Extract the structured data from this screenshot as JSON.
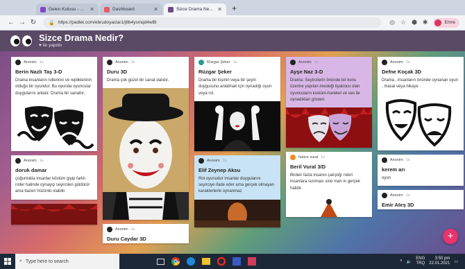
{
  "browser": {
    "tabs": [
      {
        "label": "Gelen Kutusu - Yahoo Search",
        "color": "#7b4bc4"
      },
      {
        "label": "Dashboard",
        "color": "#e35b6c"
      },
      {
        "label": "Sizce Drama Nedir?",
        "color": "#6d4a86"
      }
    ],
    "url": "https://padlet.com/ebrudoyaclar1/j8b4ysmqd4wBl",
    "profile_label": "Emre"
  },
  "padlet": {
    "title": "Sizce Drama Nedir?",
    "subtitle": "♥ ile yapıldı"
  },
  "columns": [
    {
      "cards": [
        {
          "author": "Anonim",
          "time": "1s",
          "title": "Berin Nazlı Taş 3-D",
          "body": "Drama insanların rollerinin ve repliklerinin olduğu bir oyundur. Bu oyunda oyuncular duygularını anlatır. Drama bir sanattır.",
          "image": "masks-bw-1"
        },
        {
          "author": "Anonim",
          "time": "1s",
          "title": "doruk damar",
          "body": "çoğunlukla insanlar köstüm giyip farklı roller halinde oynayıp seyircileri güldürür ama bazen hüzünlü olabilir.",
          "image": ""
        },
        {
          "author": "",
          "time": "",
          "title": "",
          "body": "",
          "image": "red-curtain-small"
        }
      ]
    },
    {
      "cards": [
        {
          "author": "Anonim",
          "time": "1s",
          "title": "Duru 3D",
          "body": "Drama çok güzel bir sanat dalıdır.",
          "image": "mime-boy"
        },
        {
          "author": "Anonim",
          "time": "1s",
          "title": "Duru Caydar 3D",
          "body": "",
          "image": ""
        }
      ]
    },
    {
      "cards": [
        {
          "author": "Rüzgar Şeker",
          "time": "1s",
          "title": "Rüzgar Şeker",
          "body": "Drama bir kişinin veya bir şeyin duygusunu anlatmak için oynadığı oyun veya rol.",
          "image": "mime-woman"
        },
        {
          "author": "Anonim",
          "time": "1s",
          "title": "Elif  Zeynep  Aksu",
          "body": "Rol oyunudur insanlar duygularını seyirciye ifade eder ama  gerçek olmayan karakterlerle oynanmaz",
          "image": "stage-dark",
          "tone": "blue"
        }
      ]
    },
    {
      "cards": [
        {
          "author": "Anonim",
          "time": "1s",
          "title": "Ayşe Naz 3-D",
          "body": "Drama: Seyircilerin önünde bir konu üzerine  yapılan mesleği tiyatrocu olan oyuncuların kostüm-hareket ve ses ile oynadıkları gösteri.",
          "image": "masks-curtain",
          "tone": "purple"
        },
        {
          "author": "hatice vural",
          "time": "1s",
          "title": "Beril Vural 3/D",
          "body": "Birden fazla insanın  çalıştığı roleri insanlara sunması sine man in gerçek halidir.",
          "image": ""
        }
      ]
    },
    {
      "cards": [
        {
          "author": "Anonim",
          "time": "1s",
          "title": "Defne Koçak 3D",
          "body": "Drama , insanların önünde oynanan oyun , masal veya hikaye .",
          "image": "masks-outline"
        },
        {
          "author": "Anonim",
          "time": "1s",
          "title": "kerem arı",
          "body": "oyun",
          "image": ""
        },
        {
          "author": "Anonim",
          "time": "1s",
          "title": "Emir Ateş 3D",
          "body": "",
          "image": ""
        }
      ]
    }
  ],
  "taskbar": {
    "search_placeholder": "Type here to search",
    "language": "ENG",
    "lang_sub": "TRQ",
    "time": "3:50 pm",
    "date": "22.01.2021"
  }
}
